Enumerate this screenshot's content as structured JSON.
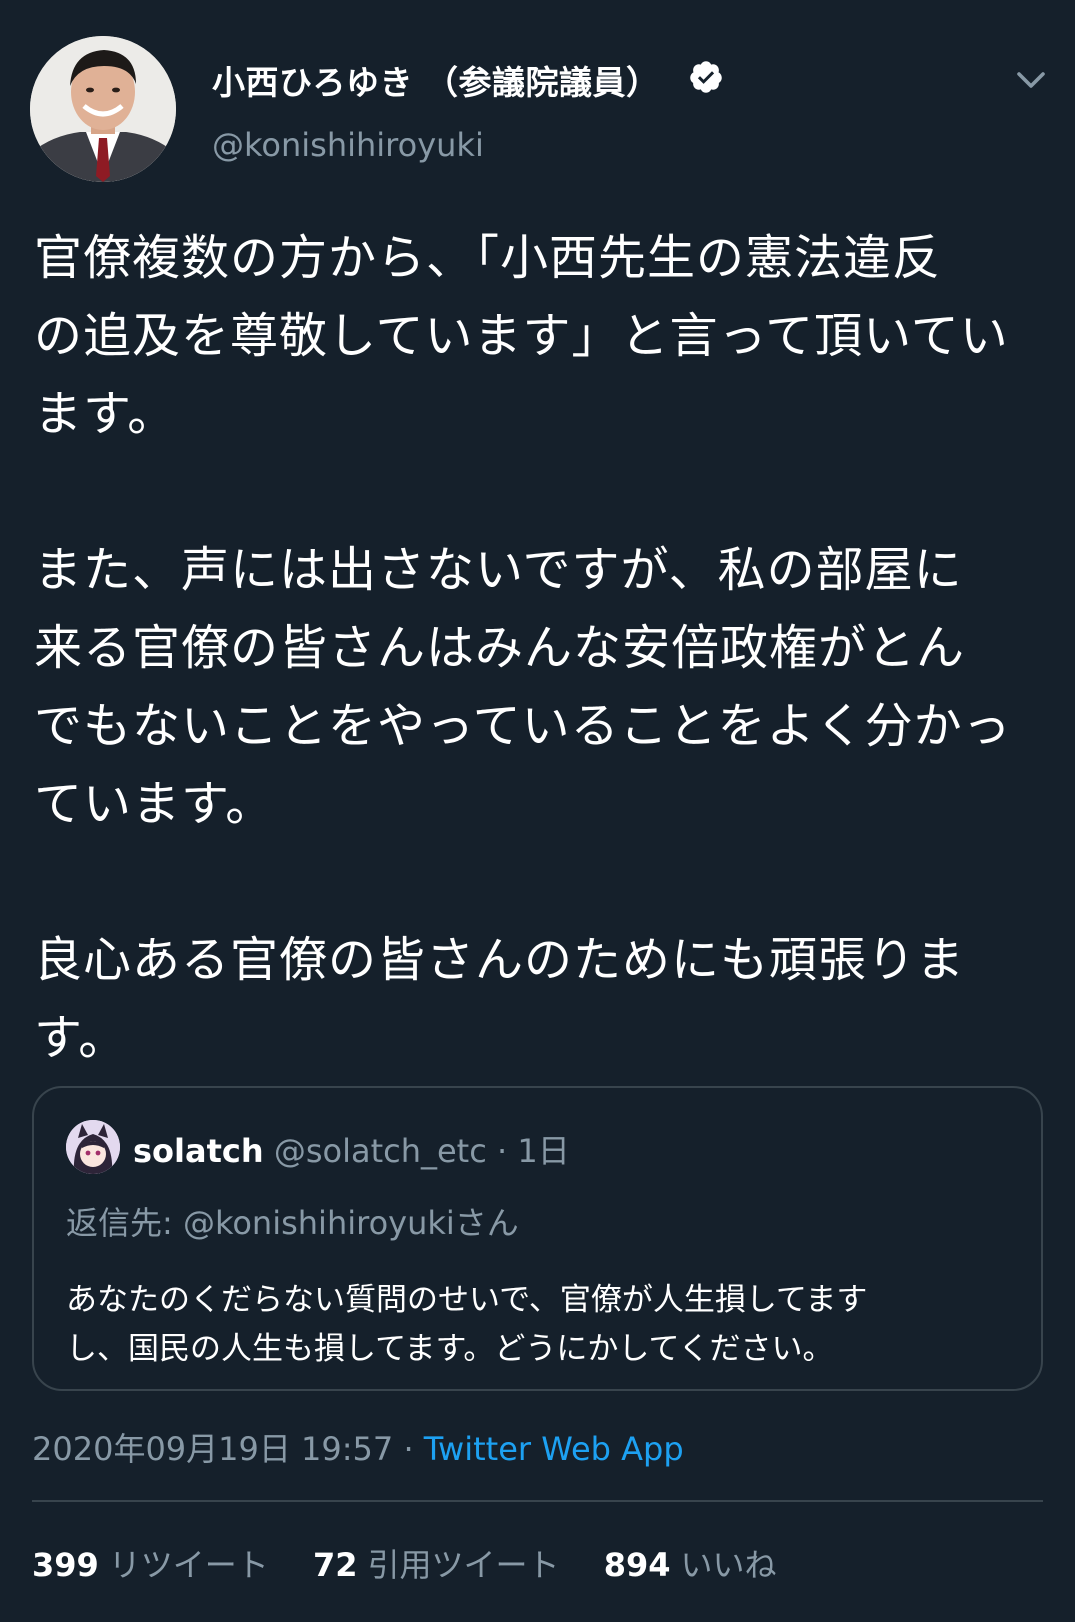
{
  "author": {
    "display_name": "小西ひろゆき （参議院議員）",
    "handle": "@konishihiroyuki",
    "verified_icon": "verified-badge-icon"
  },
  "tweet": {
    "text": "官僚複数の方から、「小西先生の憲法違反\nの追及を尊敬しています」と言って頂いてい\nます。\n\nまた、声には出さないですが、私の部屋に\n来る官僚の皆さんはみんな安倍政権がとん\nでもないことをやっていることをよく分かっ\nています。\n\n良心ある官僚の皆さんのためにも頑張りま\nす。"
  },
  "quoted_tweet": {
    "name": "solatch",
    "handle": "@solatch_etc",
    "separator": "·",
    "time": "1日",
    "reply_to": "返信先: @konishihiroyukiさん",
    "text": "あなたのくだらない質問のせいで、官僚が人生損してます\nし、国民の人生も損してます。どうにかしてください。"
  },
  "meta": {
    "timestamp": "2020年09月19日 19:57",
    "separator": "·",
    "source": "Twitter Web App"
  },
  "stats": {
    "retweets_count": "399",
    "retweets_label": "リツイート",
    "quotes_count": "72",
    "quotes_label": "引用ツイート",
    "likes_count": "894",
    "likes_label": "いいね"
  },
  "colors": {
    "background": "#15202b",
    "text_primary": "#ffffff",
    "text_secondary": "#8899a6",
    "link": "#1da1f2",
    "border": "#38444d"
  }
}
